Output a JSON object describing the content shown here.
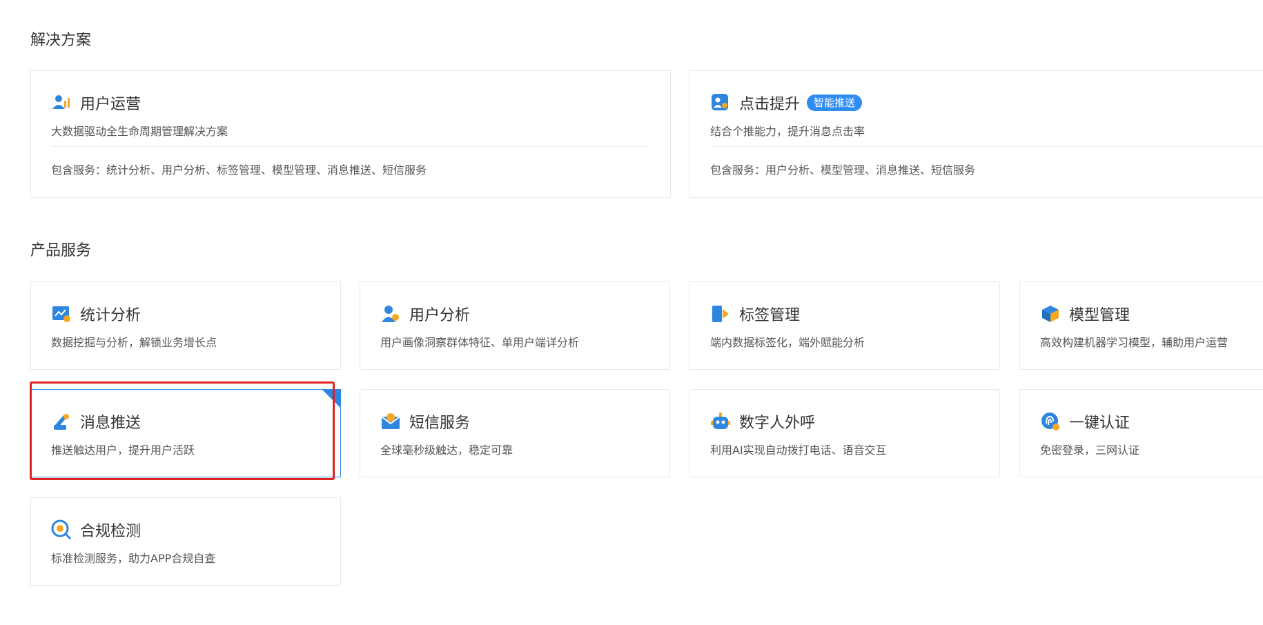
{
  "sections": {
    "solutions_title": "解决方案",
    "products_title": "产品服务"
  },
  "solutions": [
    {
      "title": "用户运营",
      "desc": "大数据驱动全生命周期管理解决方案",
      "services": "包含服务：统计分析、用户分析、标签管理、模型管理、消息推送、短信服务",
      "icon": "user-operation-icon"
    },
    {
      "title": "点击提升",
      "tag": "智能推送",
      "desc": "结合个推能力，提升消息点击率",
      "services": "包含服务：用户分析、模型管理、消息推送、短信服务",
      "icon": "click-boost-icon"
    }
  ],
  "products": [
    {
      "title": "统计分析",
      "desc": "数据挖掘与分析，解锁业务增长点",
      "icon": "statistics-icon"
    },
    {
      "title": "用户分析",
      "desc": "用户画像洞察群体特征、单用户端详分析",
      "icon": "user-analysis-icon"
    },
    {
      "title": "标签管理",
      "desc": "端内数据标签化，端外赋能分析",
      "icon": "tag-icon"
    },
    {
      "title": "模型管理",
      "desc": "高效构建机器学习模型，辅助用户运营",
      "icon": "model-icon"
    },
    {
      "title": "消息推送",
      "desc": "推送触达用户，提升用户活跃",
      "icon": "push-icon",
      "selected": true
    },
    {
      "title": "短信服务",
      "desc": "全球毫秒级触达，稳定可靠",
      "icon": "sms-icon"
    },
    {
      "title": "数字人外呼",
      "desc": "利用AI实现自动拨打电话、语音交互",
      "icon": "robot-icon"
    },
    {
      "title": "一键认证",
      "desc": "免密登录，三网认证",
      "icon": "fingerprint-icon"
    },
    {
      "title": "合规检测",
      "desc": "标准检测服务，助力APP合规自查",
      "icon": "compliance-icon"
    }
  ],
  "colors": {
    "accent": "#2e86de",
    "highlight": "#e02020",
    "icon_orange": "#f5a623"
  }
}
